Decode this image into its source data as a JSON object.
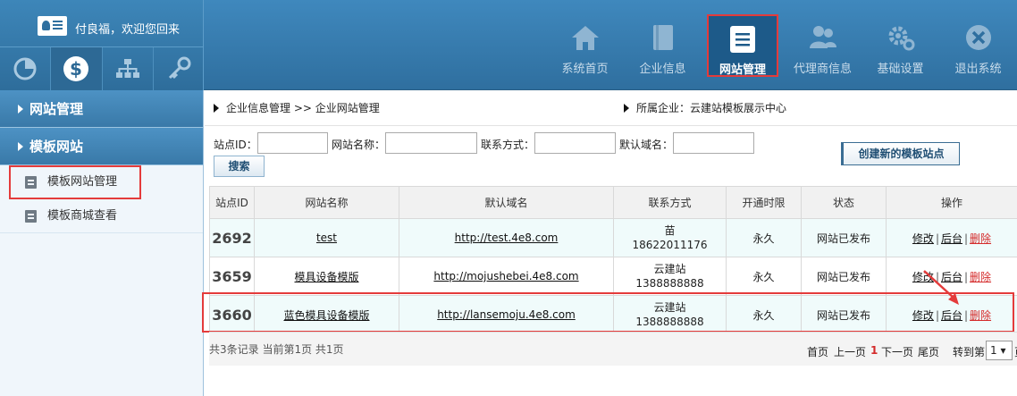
{
  "user": {
    "greeting": "付良福，欢迎您回来"
  },
  "quick_icons": [
    "pie-chart-icon",
    "dollar-icon",
    "sitemap-icon",
    "key-icon"
  ],
  "topnav": [
    {
      "label": "系统首页",
      "icon": "home-icon"
    },
    {
      "label": "企业信息",
      "icon": "book-icon"
    },
    {
      "label": "网站管理",
      "icon": "list-icon",
      "active": true
    },
    {
      "label": "代理商信息",
      "icon": "users-icon"
    },
    {
      "label": "基础设置",
      "icon": "gear-icon"
    },
    {
      "label": "退出系统",
      "icon": "close-icon"
    }
  ],
  "sidebar": {
    "sections": [
      {
        "label": "网站管理"
      },
      {
        "label": "模板网站"
      }
    ],
    "items": [
      {
        "label": "模板网站管理"
      },
      {
        "label": "模板商城查看"
      }
    ]
  },
  "breadcrumb": {
    "path": "企业信息管理 >> 企业网站管理",
    "company": "所属企业：云建站模板展示中心"
  },
  "search": {
    "id_label": "站点ID：",
    "name_label": "网站名称：",
    "contact_label": "联系方式：",
    "domain_label": "默认域名：",
    "button": "搜索",
    "create_button": "创建新的模板站点"
  },
  "table": {
    "headers": [
      "站点ID",
      "网站名称",
      "默认域名",
      "联系方式",
      "开通时限",
      "状态",
      "操作"
    ],
    "rows": [
      {
        "id": "2692",
        "name": "test",
        "domain": "http://test.4e8.com",
        "contact_name": "苗",
        "contact_phone": "18622011176",
        "period": "永久",
        "status": "网站已发布",
        "edit": "修改",
        "admin": "后台",
        "delete": "删除"
      },
      {
        "id": "3659",
        "name": "模具设备模版",
        "domain": "http://mojushebei.4e8.com",
        "contact_name": "云建站",
        "contact_phone": "1388888888",
        "period": "永久",
        "status": "网站已发布",
        "edit": "修改",
        "admin": "后台",
        "delete": "删除"
      },
      {
        "id": "3660",
        "name": "蓝色模具设备模版",
        "domain": "http://lansemoju.4e8.com",
        "contact_name": "云建站",
        "contact_phone": "1388888888",
        "period": "永久",
        "status": "网站已发布",
        "edit": "修改",
        "admin": "后台",
        "delete": "删除"
      }
    ]
  },
  "pager": {
    "info": "共3条记录 当前第1页 共1页",
    "first": "首页",
    "prev": "上一页",
    "current": "1",
    "next": "下一页",
    "last": "尾页",
    "goto": "转到第",
    "page_value": "1 ▾",
    "page_suffix": "页"
  },
  "colors": {
    "header": "#3f88bd",
    "highlight": "#e43b3b",
    "ok": "#2f8a2f",
    "danger": "#d42b2b"
  }
}
